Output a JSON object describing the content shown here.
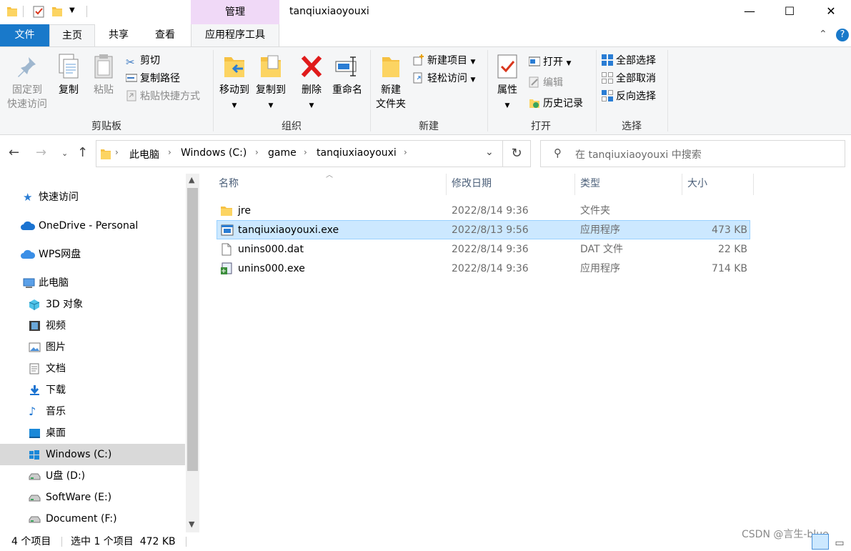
{
  "window": {
    "title": "tanqiuxiaoyouxi",
    "manage_tab": "管理",
    "minimize_icon": "minimize-icon",
    "maximize_icon": "maximize-icon",
    "close_icon": "close-icon"
  },
  "tabs": {
    "file": "文件",
    "home": "主页",
    "share": "共享",
    "view": "查看",
    "app_tools": "应用程序工具"
  },
  "ribbon": {
    "clipboard": {
      "label": "剪贴板",
      "pin": "固定到",
      "pin2": "快速访问",
      "copy": "复制",
      "paste": "粘贴",
      "cut": "剪切",
      "copy_path": "复制路径",
      "paste_shortcut": "粘贴快捷方式"
    },
    "organize": {
      "label": "组织",
      "move_to": "移动到",
      "copy_to": "复制到",
      "delete": "删除",
      "rename": "重命名"
    },
    "new": {
      "label": "新建",
      "new_folder": "新建",
      "new_folder2": "文件夹",
      "new_item": "新建项目",
      "easy_access": "轻松访问"
    },
    "open": {
      "label": "打开",
      "properties": "属性",
      "open": "打开",
      "edit": "编辑",
      "history": "历史记录"
    },
    "select": {
      "label": "选择",
      "select_all": "全部选择",
      "select_none": "全部取消",
      "invert": "反向选择"
    }
  },
  "address": {
    "crumbs": [
      "此电脑",
      "Windows (C:)",
      "game",
      "tanqiuxiaoyouxi"
    ],
    "search_placeholder": "在 tanqiuxiaoyouxi 中搜索"
  },
  "nav": {
    "quick_access": "快速访问",
    "onedrive": "OneDrive - Personal",
    "wps": "WPS网盘",
    "this_pc": "此电脑",
    "items": [
      "3D 对象",
      "视频",
      "图片",
      "文档",
      "下载",
      "音乐",
      "桌面",
      "Windows (C:)",
      "U盘 (D:)",
      "SoftWare (E:)",
      "Document (F:)"
    ]
  },
  "columns": {
    "name": "名称",
    "modified": "修改日期",
    "type": "类型",
    "size": "大小"
  },
  "files": [
    {
      "name": "jre",
      "date": "2022/8/14 9:36",
      "type": "文件夹",
      "size": ""
    },
    {
      "name": "tanqiuxiaoyouxi.exe",
      "date": "2022/8/13 9:56",
      "type": "应用程序",
      "size": "473 KB"
    },
    {
      "name": "unins000.dat",
      "date": "2022/8/14 9:36",
      "type": "DAT 文件",
      "size": "22 KB"
    },
    {
      "name": "unins000.exe",
      "date": "2022/8/14 9:36",
      "type": "应用程序",
      "size": "714 KB"
    }
  ],
  "status": {
    "count": "4 个项目",
    "selection": "选中 1 个项目  472 KB",
    "watermark": "CSDN @言生-blue"
  },
  "colors": {
    "accent": "#1979ca",
    "selected_row": "#cce8ff",
    "manage_tab": "#f0d9f7"
  }
}
